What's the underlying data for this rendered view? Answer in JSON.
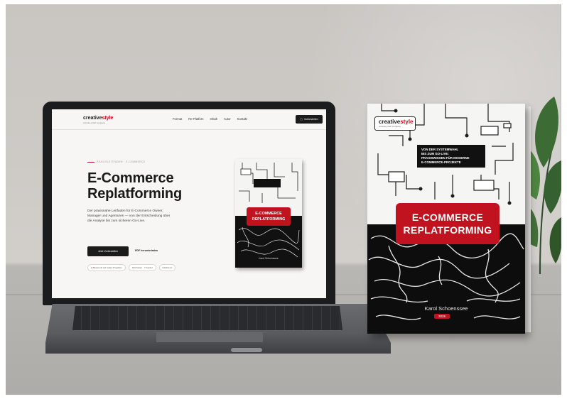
{
  "laptop_site": {
    "logo": {
      "main": "creative",
      "accent": "style",
      "sub": "a future-proof company"
    },
    "nav": [
      "Format",
      "Re-Platforn",
      "Inhalt",
      "Autor",
      "Kontakt"
    ],
    "nav_button": "Vorbestellen",
    "eyebrow": "PRAXISLEITFADEN · E-COMMERCE",
    "hero_title_line1": "E-Commerce",
    "hero_title_line2": "Replatforming",
    "hero_desc": "Der praxisnahe Leitfaden für E-Commerce Owner, Manager und Agenturen — von der Entscheidung über die Analyse bis zum sicheren Go-Live.",
    "btn_primary": "Jetzt Vorbestellen",
    "btn_secondary": "PDF herunterladen",
    "badges": [
      "Basierend auf realen Projekten",
      "160 Seiten · 7 Kapitel",
      "Hardcover"
    ],
    "mini_book": {
      "title_line1": "E-COMMERCE",
      "title_line2": "REPLATFORMING",
      "author": "Karol Schoenssee"
    }
  },
  "book": {
    "logo": {
      "main": "creative",
      "accent": "style",
      "sub": "a future-proof company"
    },
    "subtitle": [
      "VON DER SYSTEMWAHL",
      "BIS ZUM GO-LIVE:",
      "PRAXISWISSEN FÜR MODERNE",
      "E-COMMERCE-PROJEKTE"
    ],
    "title_line1": "E-COMMERCE",
    "title_line2": "REPLATFORMING",
    "author": "Karol Schoenssee",
    "year": "2026"
  },
  "colors": {
    "accent": "#c1121f",
    "dark": "#111111",
    "wall": "#cac7c3"
  }
}
